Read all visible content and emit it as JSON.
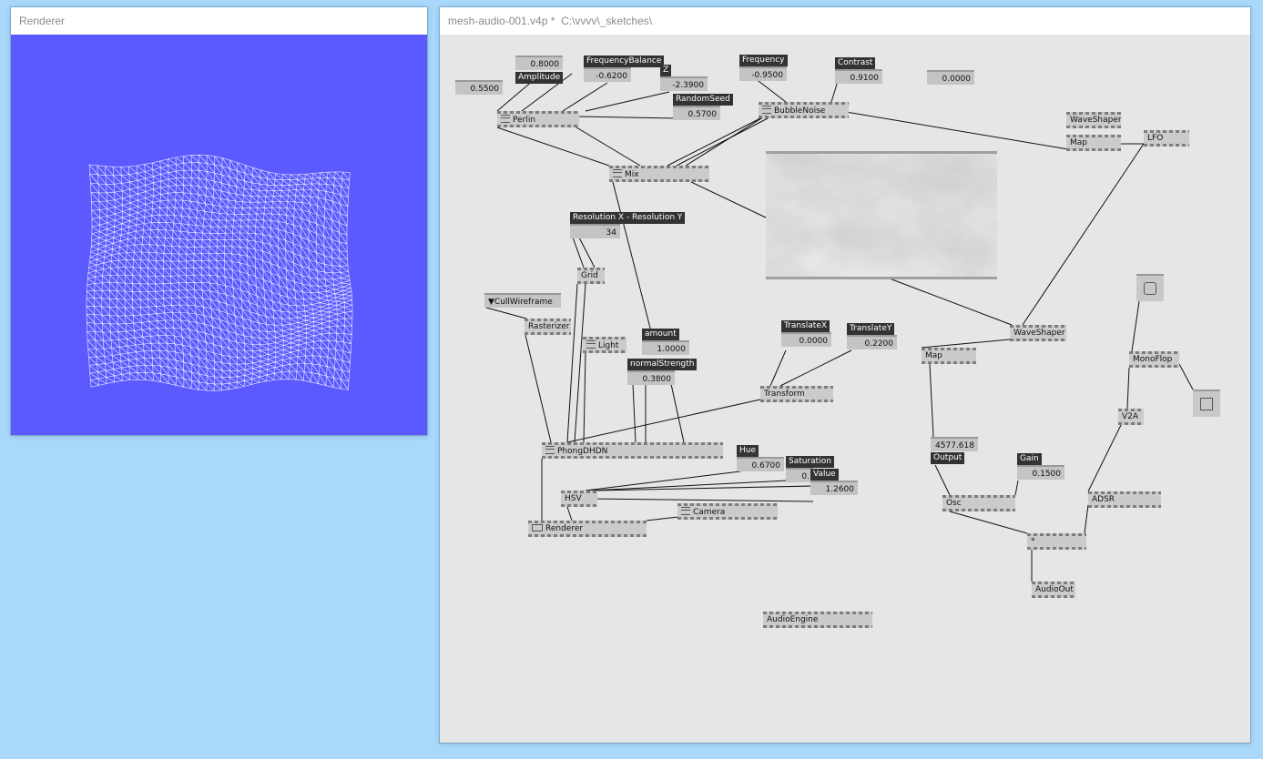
{
  "renderer_window": {
    "title": "Renderer"
  },
  "patch_window": {
    "title": "mesh-audio-001.v4p *  C:\\vvvv\\_sketches\\"
  },
  "colors": {
    "render_background": "#5a5aff",
    "wireframe": "#ffffff",
    "patch_background": "#e6e6e6",
    "desktop": "#a9d8fb"
  },
  "nodes": {
    "perlin": "Perlin",
    "bubble_noise": "BubbleNoise",
    "mix": "Mix",
    "grid": "Grid",
    "rasterizer": "Rasterizer",
    "light": "Light",
    "transform": "Transform",
    "phong": "PhongDHDN",
    "hsv": "HSV",
    "renderer": "Renderer",
    "camera": "Camera",
    "waveshaper_top": "WaveShaper",
    "map_top": "Map",
    "lfo": "LFO",
    "waveshaper_mid": "WaveShaper",
    "map_mid": "Map",
    "monoflop": "MonoFlop",
    "v2a": "V2A",
    "osc": "Osc",
    "adsr": "ADSR",
    "multiply": "*",
    "audio_out": "AudioOut",
    "audio_engine": "AudioEngine"
  },
  "labels": {
    "amplitude": "Amplitude",
    "frequency_balance": "FrequencyBalance",
    "z": "Z",
    "random_seed": "RandomSeed",
    "frequency": "Frequency",
    "contrast": "Contrast",
    "resolution": "Resolution X - Resolution Y",
    "cull_wireframe": "▼CullWireframe",
    "amount": "amount",
    "normal_strength": "normalStrength",
    "translate_x": "TranslateX",
    "translate_y": "TranslateY",
    "hue": "Hue",
    "saturation": "Saturation",
    "value": "Value",
    "output": "Output",
    "gain": "Gain"
  },
  "values": {
    "amplitude": "0.8000",
    "free_left": "0.5500",
    "frequency_balance": "-0.6200",
    "z": "-2.3900",
    "random_seed": "0.5700",
    "frequency": "-0.9500",
    "contrast": "0.9100",
    "free_right": "0.0000",
    "resolution": "34",
    "amount": "1.0000",
    "normal_strength": "0.3800",
    "translate_x": "0.0000",
    "translate_y": "0.2200",
    "hue": "0.6700",
    "saturation": "0.",
    "value": "1.2600",
    "output": "4577.618",
    "gain": "0.1500"
  }
}
